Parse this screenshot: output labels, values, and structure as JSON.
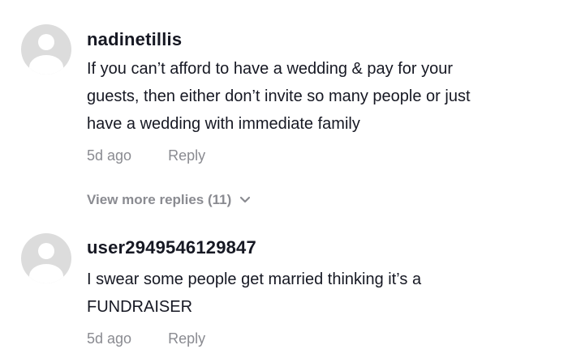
{
  "comments": [
    {
      "username": "nadinetillis",
      "lines": [
        "If you can’t afford to have a wedding & pay for your",
        "guests, then either don’t invite so many people or just",
        "have a wedding with immediate family"
      ],
      "time": "5d ago",
      "reply_label": "Reply"
    },
    {
      "username": "user2949546129847",
      "lines": [
        "I swear some people get married thinking it’s a",
        "FUNDRAISER"
      ],
      "time": "5d ago",
      "reply_label": "Reply"
    }
  ],
  "view_more": {
    "label": "View more replies (11)",
    "icon": "chevron-down-icon"
  }
}
